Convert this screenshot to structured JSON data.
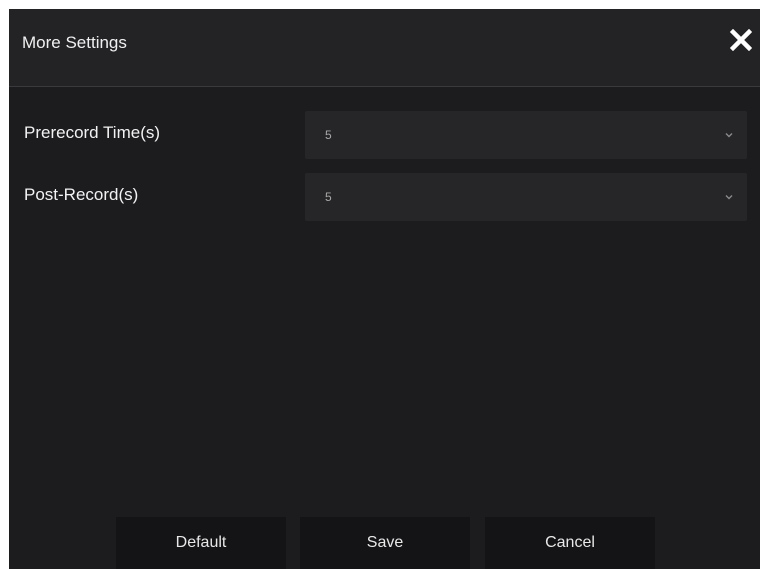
{
  "dialog": {
    "title": "More Settings",
    "close_icon": "close-icon"
  },
  "fields": [
    {
      "label": "Prerecord Time(s)",
      "value": "5",
      "icon": "chevron-down-icon"
    },
    {
      "label": "Post-Record(s)",
      "value": "5",
      "icon": "chevron-down-icon"
    }
  ],
  "footer": {
    "default_label": "Default",
    "save_label": "Save",
    "cancel_label": "Cancel"
  },
  "colors": {
    "background": "#1c1c1f",
    "header": "#232326",
    "select": "#262628",
    "button": "#141416",
    "text": "#f2f2f2",
    "muted_text": "#a8a8a8"
  }
}
